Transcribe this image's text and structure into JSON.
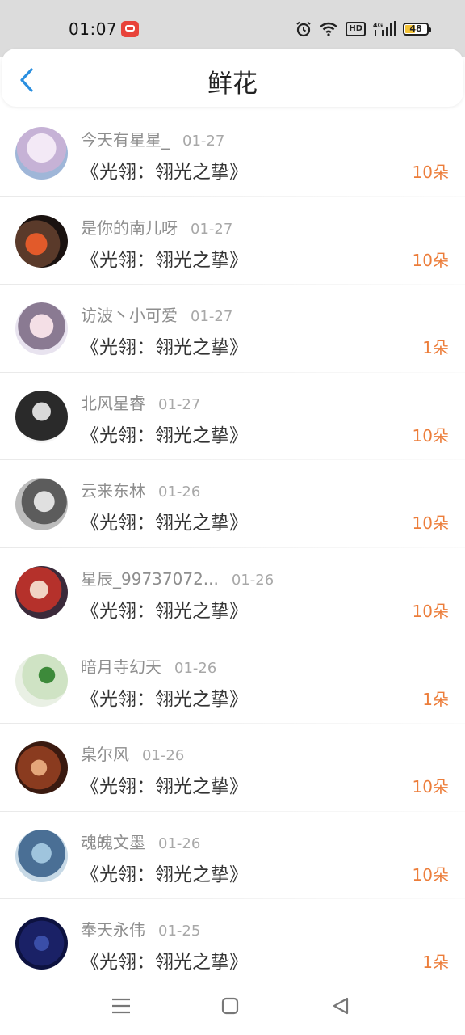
{
  "status_bar": {
    "time": "01:07",
    "battery": "48",
    "battery_level": 0.48,
    "network": "4G",
    "hd_label": "HD",
    "icons": [
      "app-notification-icon",
      "alarm-icon",
      "wifi-icon",
      "hd-icon",
      "signal-icon",
      "battery-icon"
    ]
  },
  "header": {
    "title": "鲜花",
    "back_icon": "chevron-left-icon",
    "accent_color": "#2a8fe0"
  },
  "rows": [
    {
      "username": "今天有星星_",
      "date": "01-27",
      "book": "《光翎：翎光之挚》",
      "count": "10朵"
    },
    {
      "username": "是你的南儿呀",
      "date": "01-27",
      "book": "《光翎：翎光之挚》",
      "count": "10朵"
    },
    {
      "username": "访波丶小可爱",
      "date": "01-27",
      "book": "《光翎：翎光之挚》",
      "count": "1朵"
    },
    {
      "username": "北风星睿",
      "date": "01-27",
      "book": "《光翎：翎光之挚》",
      "count": "10朵"
    },
    {
      "username": "云来东林",
      "date": "01-26",
      "book": "《光翎：翎光之挚》",
      "count": "10朵"
    },
    {
      "username": "星辰_99737072...",
      "date": "01-26",
      "book": "《光翎：翎光之挚》",
      "count": "10朵"
    },
    {
      "username": "暗月寺幻天",
      "date": "01-26",
      "book": "《光翎：翎光之挚》",
      "count": "1朵"
    },
    {
      "username": "臬尔风",
      "date": "01-26",
      "book": "《光翎：翎光之挚》",
      "count": "10朵"
    },
    {
      "username": "魂魄文墨",
      "date": "01-26",
      "book": "《光翎：翎光之挚》",
      "count": "10朵"
    },
    {
      "username": "奉天永伟",
      "date": "01-25",
      "book": "《光翎：翎光之挚》",
      "count": "1朵"
    }
  ],
  "colors": {
    "count": "#ec7d3a",
    "username": "#8e8e8e",
    "book": "#333333"
  },
  "nav_bar": {
    "icons": [
      "menu-icon",
      "home-icon",
      "back-triangle-icon"
    ]
  }
}
